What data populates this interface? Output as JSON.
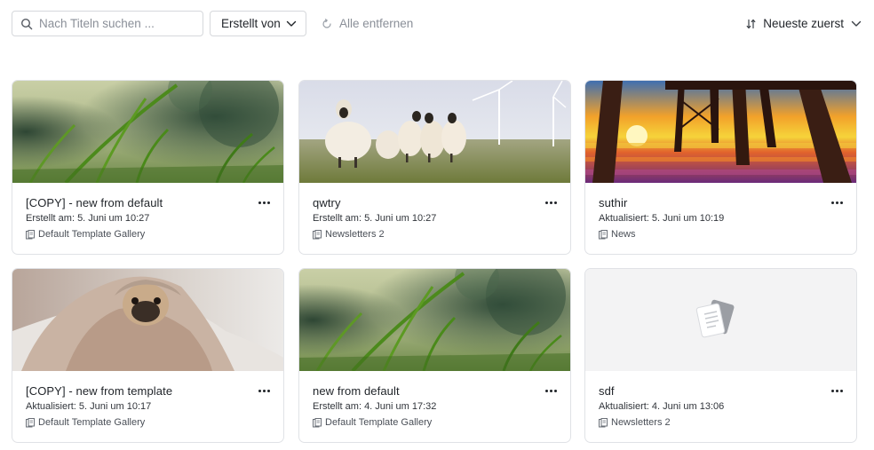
{
  "toolbar": {
    "search_placeholder": "Nach Titeln suchen ...",
    "search_value": "",
    "filter_label": "Erstellt von",
    "clear_label": "Alle entfernen",
    "sort_label": "Neueste zuerst"
  },
  "cards": [
    {
      "title": "[COPY] - new from default",
      "meta": "Erstellt am: 5. Juni um 10:27",
      "folder": "Default Template Gallery",
      "image": "grass"
    },
    {
      "title": "qwtry",
      "meta": "Erstellt am: 5. Juni um 10:27",
      "folder": "Newsletters 2",
      "image": "sheep"
    },
    {
      "title": "suthir",
      "meta": "Aktualisiert: 5. Juni um 10:19",
      "folder": "News",
      "image": "pier-sunset"
    },
    {
      "title": "[COPY] - new from template",
      "meta": "Aktualisiert: 5. Juni um 10:17",
      "folder": "Default Template Gallery",
      "image": "pug-blanket"
    },
    {
      "title": "new from default",
      "meta": "Erstellt am: 4. Juni um 17:32",
      "folder": "Default Template Gallery",
      "image": "grass"
    },
    {
      "title": "sdf",
      "meta": "Aktualisiert: 4. Juni um 13:06",
      "folder": "Newsletters 2",
      "image": "document-placeholder-icon"
    }
  ],
  "colors": {
    "border": "#e0e2e6",
    "text": "#1f2328",
    "muted": "#8a8f98",
    "placeholder_bg": "#f3f3f4"
  }
}
